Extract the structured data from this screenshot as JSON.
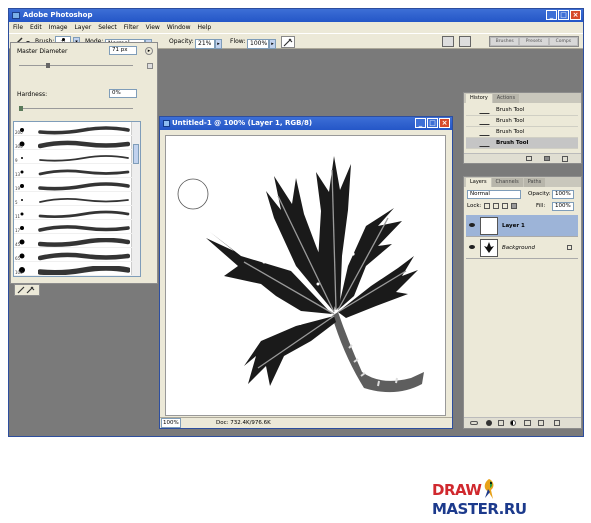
{
  "app": {
    "title": "Adobe Photoshop",
    "window_controls": [
      "_",
      "□",
      "×"
    ]
  },
  "menu": [
    "File",
    "Edit",
    "Image",
    "Layer",
    "Select",
    "Filter",
    "View",
    "Window",
    "Help"
  ],
  "options_bar": {
    "brush_label": "Brush:",
    "brush_size": "71",
    "mode_label": "Mode:",
    "mode_value": "Normal",
    "opacity_label": "Opacity:",
    "opacity_value": "21%",
    "flow_label": "Flow:",
    "flow_value": "100%",
    "palette_well": [
      "Brushes",
      "Presets",
      "Comps"
    ]
  },
  "brush_picker": {
    "master_diameter_label": "Master Diameter",
    "master_diameter_value": "71 px",
    "master_diameter_fraction": 0.25,
    "hardness_label": "Hardness:",
    "hardness_value": "0%",
    "hardness_fraction": 0,
    "brushes": [
      {
        "size": "200",
        "dot": 4
      },
      {
        "size": "300",
        "dot": 5
      },
      {
        "size": "9",
        "dot": 2
      },
      {
        "size": "13",
        "dot": 3
      },
      {
        "size": "19",
        "dot": 4
      },
      {
        "size": "5",
        "dot": 2
      },
      {
        "size": "11",
        "dot": 3
      },
      {
        "size": "17",
        "dot": 4
      },
      {
        "size": "45",
        "dot": 5
      },
      {
        "size": "65",
        "dot": 5
      },
      {
        "size": "100",
        "dot": 6
      }
    ]
  },
  "document": {
    "title": "Untitled-1 @ 100% (Layer 1, RGB/8)",
    "zoom": "100%",
    "doc_info": "Doc: 732.4K/976.6K"
  },
  "history": {
    "tabs": [
      "History",
      "Actions"
    ],
    "items": [
      "Brush Tool",
      "Brush Tool",
      "Brush Tool",
      "Brush Tool"
    ]
  },
  "layers": {
    "tabs": [
      "Layers",
      "Channels",
      "Paths"
    ],
    "blend_mode": "Normal",
    "opacity_label": "Opacity:",
    "opacity_value": "100%",
    "lock_label": "Lock:",
    "fill_label": "Fill:",
    "fill_value": "100%",
    "items": [
      {
        "name": "Layer 1",
        "selected": true
      },
      {
        "name": "Background",
        "selected": false
      }
    ]
  },
  "watermark": {
    "draw": "DRAW",
    "master": "MASTER.RU"
  },
  "colors": {
    "titlebar": "#2456c7",
    "workspace": "#7a7a7a",
    "panel": "#ece9d8",
    "watermark_red": "#d0282e",
    "watermark_blue": "#1c3a8c"
  }
}
